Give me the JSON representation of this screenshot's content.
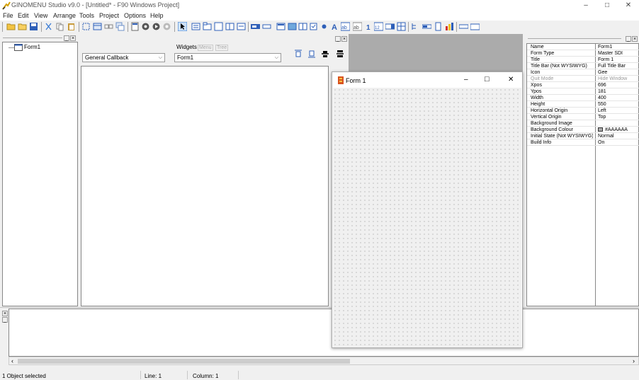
{
  "window": {
    "title": "GINOMENU Studio v9.0 - [Untitled* - F90 Windows Project]",
    "minimize": "–",
    "maximize": "□",
    "close": "✕"
  },
  "menu": [
    "File",
    "Edit",
    "View",
    "Arrange",
    "Tools",
    "Project",
    "Options",
    "Help"
  ],
  "tree": {
    "root_label": "Form1"
  },
  "editor": {
    "callback_combo": "General Callback",
    "widgets_tab": "Widgets",
    "menu_tab": "Menu",
    "tree_tab": "Tree",
    "object_combo": "Form1"
  },
  "form_preview": {
    "title": "Form 1",
    "minimize": "–",
    "maximize": "□",
    "close": "✕"
  },
  "properties": {
    "rows": [
      {
        "name": "Name",
        "value": "Form1"
      },
      {
        "name": "Form Type",
        "value": "Master SDI"
      },
      {
        "name": "Title",
        "value": "Form 1"
      },
      {
        "name": "Title Bar (Not WYSIWYG)",
        "value": "Full Title Bar"
      },
      {
        "name": "Icon",
        "value": "Gee"
      },
      {
        "name": "Quit Mode",
        "value": "Hide Window"
      },
      {
        "name": "Xpos",
        "value": "696"
      },
      {
        "name": "Ypos",
        "value": "181"
      },
      {
        "name": "Width",
        "value": "400"
      },
      {
        "name": "Height",
        "value": "550"
      },
      {
        "name": "Horizontal Origin",
        "value": "Left"
      },
      {
        "name": "Vertical Origin",
        "value": "Top"
      },
      {
        "name": "Background Image",
        "value": ""
      },
      {
        "name": "Background Colour",
        "value": "#AAAAAA"
      },
      {
        "name": "Initial State (Not WYSIWYG)",
        "value": "Normal"
      },
      {
        "name": "Build Info",
        "value": "On"
      }
    ]
  },
  "status": {
    "selection": "1 Object selected",
    "line": "Line: 1",
    "column": "Column: 1"
  },
  "colors": {
    "background_colour_swatch": "#AAAAAA"
  }
}
